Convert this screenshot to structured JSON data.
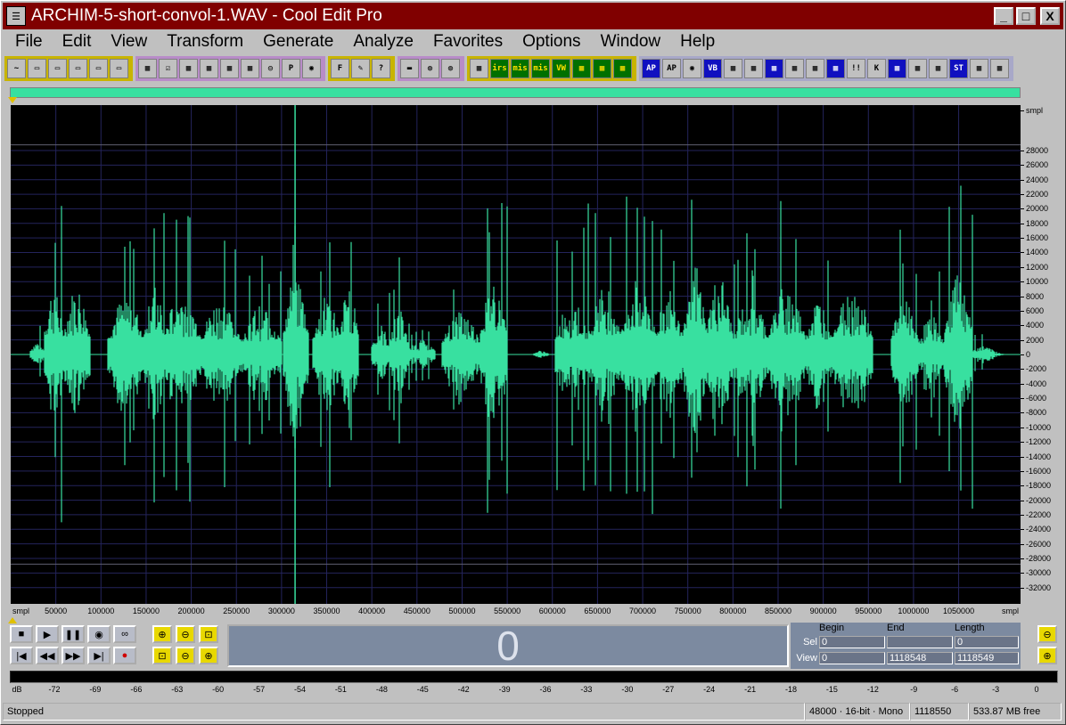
{
  "window": {
    "title": "ARCHIM-5-short-convol-1.WAV - Cool Edit Pro",
    "icon": "app-icon",
    "minimize_label": "_",
    "maximize_label": "□",
    "close_label": "X"
  },
  "menu": [
    "File",
    "Edit",
    "View",
    "Transform",
    "Generate",
    "Analyze",
    "Favorites",
    "Options",
    "Window",
    "Help"
  ],
  "toolbar": {
    "groups": [
      {
        "color": "#c8b400",
        "buttons": [
          "~",
          "▭",
          "▭",
          "▭",
          "▭",
          "▭"
        ]
      },
      {
        "color": "#b88cc8",
        "buttons": [
          "▦",
          "☑",
          "▦",
          "▦",
          "▦",
          "▦",
          "◎",
          "P",
          "◉"
        ]
      },
      {
        "color": "#c8b400",
        "buttons": [
          "F",
          "✎",
          "?"
        ]
      },
      {
        "color": "#b88cc8",
        "buttons": [
          "▬",
          "◍",
          "◍"
        ]
      },
      {
        "color": "#c8b400",
        "buttons": [
          "▦",
          "irs",
          "mis",
          "mis",
          "VW",
          "▦",
          "▦",
          "▦"
        ]
      },
      {
        "color": "#a8a8c8",
        "buttons": [
          "AP",
          "AP",
          "◉",
          "VB",
          "▦",
          "▦",
          "▦",
          "▦",
          "▦",
          "▦",
          "!!",
          "K",
          "▦",
          "▦",
          "▦",
          "ST",
          "▦",
          "▦"
        ]
      }
    ]
  },
  "waveform": {
    "background": "#000000",
    "wave_color": "#38e0a0",
    "grid_color": "#24245c",
    "y_unit": "smpl",
    "y_ticks": [
      28000,
      26000,
      24000,
      22000,
      20000,
      18000,
      16000,
      14000,
      12000,
      10000,
      8000,
      6000,
      4000,
      2000,
      0,
      -2000,
      -4000,
      -6000,
      -8000,
      -10000,
      -12000,
      -14000,
      -16000,
      -18000,
      -20000,
      -22000,
      -24000,
      -26000,
      -28000,
      -30000,
      -32000
    ],
    "y_range": [
      -32768,
      32767
    ],
    "x_unit": "smpl",
    "x_ticks": [
      50000,
      100000,
      150000,
      200000,
      250000,
      300000,
      350000,
      400000,
      450000,
      500000,
      550000,
      600000,
      650000,
      700000,
      750000,
      800000,
      850000,
      900000,
      950000,
      1000000,
      1050000
    ],
    "x_range": [
      0,
      1118549
    ],
    "cursor_sample": 315000,
    "segments": [
      {
        "start": 22000,
        "end": 38000,
        "amp": 4000
      },
      {
        "start": 38000,
        "end": 58000,
        "amp": 21000
      },
      {
        "start": 58000,
        "end": 88000,
        "amp": 20500
      },
      {
        "start": 108000,
        "end": 148000,
        "amp": 18000
      },
      {
        "start": 148000,
        "end": 170000,
        "amp": 23000
      },
      {
        "start": 170000,
        "end": 210000,
        "amp": 20000
      },
      {
        "start": 210000,
        "end": 255000,
        "amp": 17000
      },
      {
        "start": 255000,
        "end": 300000,
        "amp": 15000
      },
      {
        "start": 302000,
        "end": 330000,
        "amp": 25000
      },
      {
        "start": 335000,
        "end": 365000,
        "amp": 18000
      },
      {
        "start": 365000,
        "end": 385000,
        "amp": 23000
      },
      {
        "start": 400000,
        "end": 420000,
        "amp": 9000
      },
      {
        "start": 420000,
        "end": 440000,
        "amp": 14000
      },
      {
        "start": 440000,
        "end": 470000,
        "amp": 4500
      },
      {
        "start": 478000,
        "end": 520000,
        "amp": 13500
      },
      {
        "start": 520000,
        "end": 550000,
        "amp": 24000
      },
      {
        "start": 580000,
        "end": 595000,
        "amp": 1200
      },
      {
        "start": 603000,
        "end": 640000,
        "amp": 17500
      },
      {
        "start": 640000,
        "end": 675000,
        "amp": 22000
      },
      {
        "start": 675000,
        "end": 715000,
        "amp": 23500
      },
      {
        "start": 715000,
        "end": 745000,
        "amp": 21000
      },
      {
        "start": 745000,
        "end": 770000,
        "amp": 28000
      },
      {
        "start": 770000,
        "end": 800000,
        "amp": 24000
      },
      {
        "start": 800000,
        "end": 840000,
        "amp": 18000
      },
      {
        "start": 840000,
        "end": 880000,
        "amp": 22000
      },
      {
        "start": 880000,
        "end": 910000,
        "amp": 17000
      },
      {
        "start": 910000,
        "end": 955000,
        "amp": 20000
      },
      {
        "start": 975000,
        "end": 1005000,
        "amp": 18000
      },
      {
        "start": 1005000,
        "end": 1035000,
        "amp": 12000
      },
      {
        "start": 1035000,
        "end": 1065000,
        "amp": 25000
      },
      {
        "start": 1065000,
        "end": 1090000,
        "amp": 3000
      },
      {
        "start": 1090000,
        "end": 1100000,
        "amp": 600
      }
    ]
  },
  "transport": {
    "stop": "■",
    "play": "▶",
    "pause": "❚❚",
    "play_loop": "◉",
    "loop": "∞",
    "go_start": "|◀",
    "rewind": "◀◀",
    "forward": "▶▶",
    "go_end": "▶|",
    "record": "●"
  },
  "zoom": [
    "⊕",
    "⊖",
    "⊡",
    "⊡",
    "⊖",
    "⊕"
  ],
  "time_display": "0",
  "selection": {
    "headers": {
      "begin": "Begin",
      "end": "End",
      "length": "Length"
    },
    "sel_label": "Sel",
    "view_label": "View",
    "sel": {
      "begin": "0",
      "end": "",
      "length": "0"
    },
    "view": {
      "begin": "0",
      "end": "1118548",
      "length": "1118549"
    }
  },
  "right_zoom": [
    "⊖",
    "⊕"
  ],
  "meter": {
    "unit": "dB",
    "ticks": [
      -72,
      -69,
      -66,
      -63,
      -60,
      -57,
      -54,
      -51,
      -48,
      -45,
      -42,
      -39,
      -36,
      -33,
      -30,
      -27,
      -24,
      -21,
      -18,
      -15,
      -12,
      -9,
      -6,
      -3,
      0
    ]
  },
  "status": {
    "state": "Stopped",
    "format": "48000 · 16-bit · Mono",
    "samples": "1118550",
    "free": "533.87 MB free"
  }
}
